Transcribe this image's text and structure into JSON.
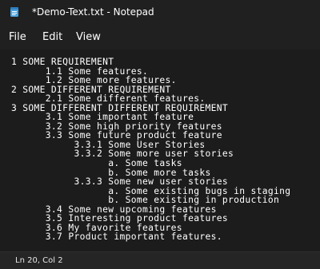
{
  "window": {
    "title": "*Demo-Text.txt - Notepad",
    "icon": "notepad-icon"
  },
  "menu": {
    "file": "File",
    "edit": "Edit",
    "view": "View"
  },
  "editor": {
    "lines": [
      "1 SOME REQUIREMENT",
      "      1.1 Some features.",
      "      1.2 Some more features.",
      "2 SOME DIFFERENT REQUIREMENT",
      "      2.1 Some different features.",
      "3 SOME DIFFERENT DIFFERENT REQUIREMENT",
      "      3.1 Some important feature",
      "      3.2 Some high priority features",
      "      3.3 Some future product feature",
      "           3.3.1 Some User Stories",
      "           3.3.2 Some more user stories",
      "                 a. Some tasks",
      "                 b. Some more tasks",
      "           3.3.3 Some new user stories",
      "                 a. Some existing bugs in staging",
      "                 b. Some existing in production",
      "      3.4 Some new upcoming features",
      "      3.5 Interesting product features",
      "      3.6 My favorite features",
      "      3.7 Product important features."
    ]
  },
  "status": {
    "cursor": "Ln 20, Col 2"
  },
  "colors": {
    "background": "#1c1c1c",
    "chrome": "#202020",
    "text": "#ffffff",
    "icon_accent": "#4aa3e0"
  }
}
